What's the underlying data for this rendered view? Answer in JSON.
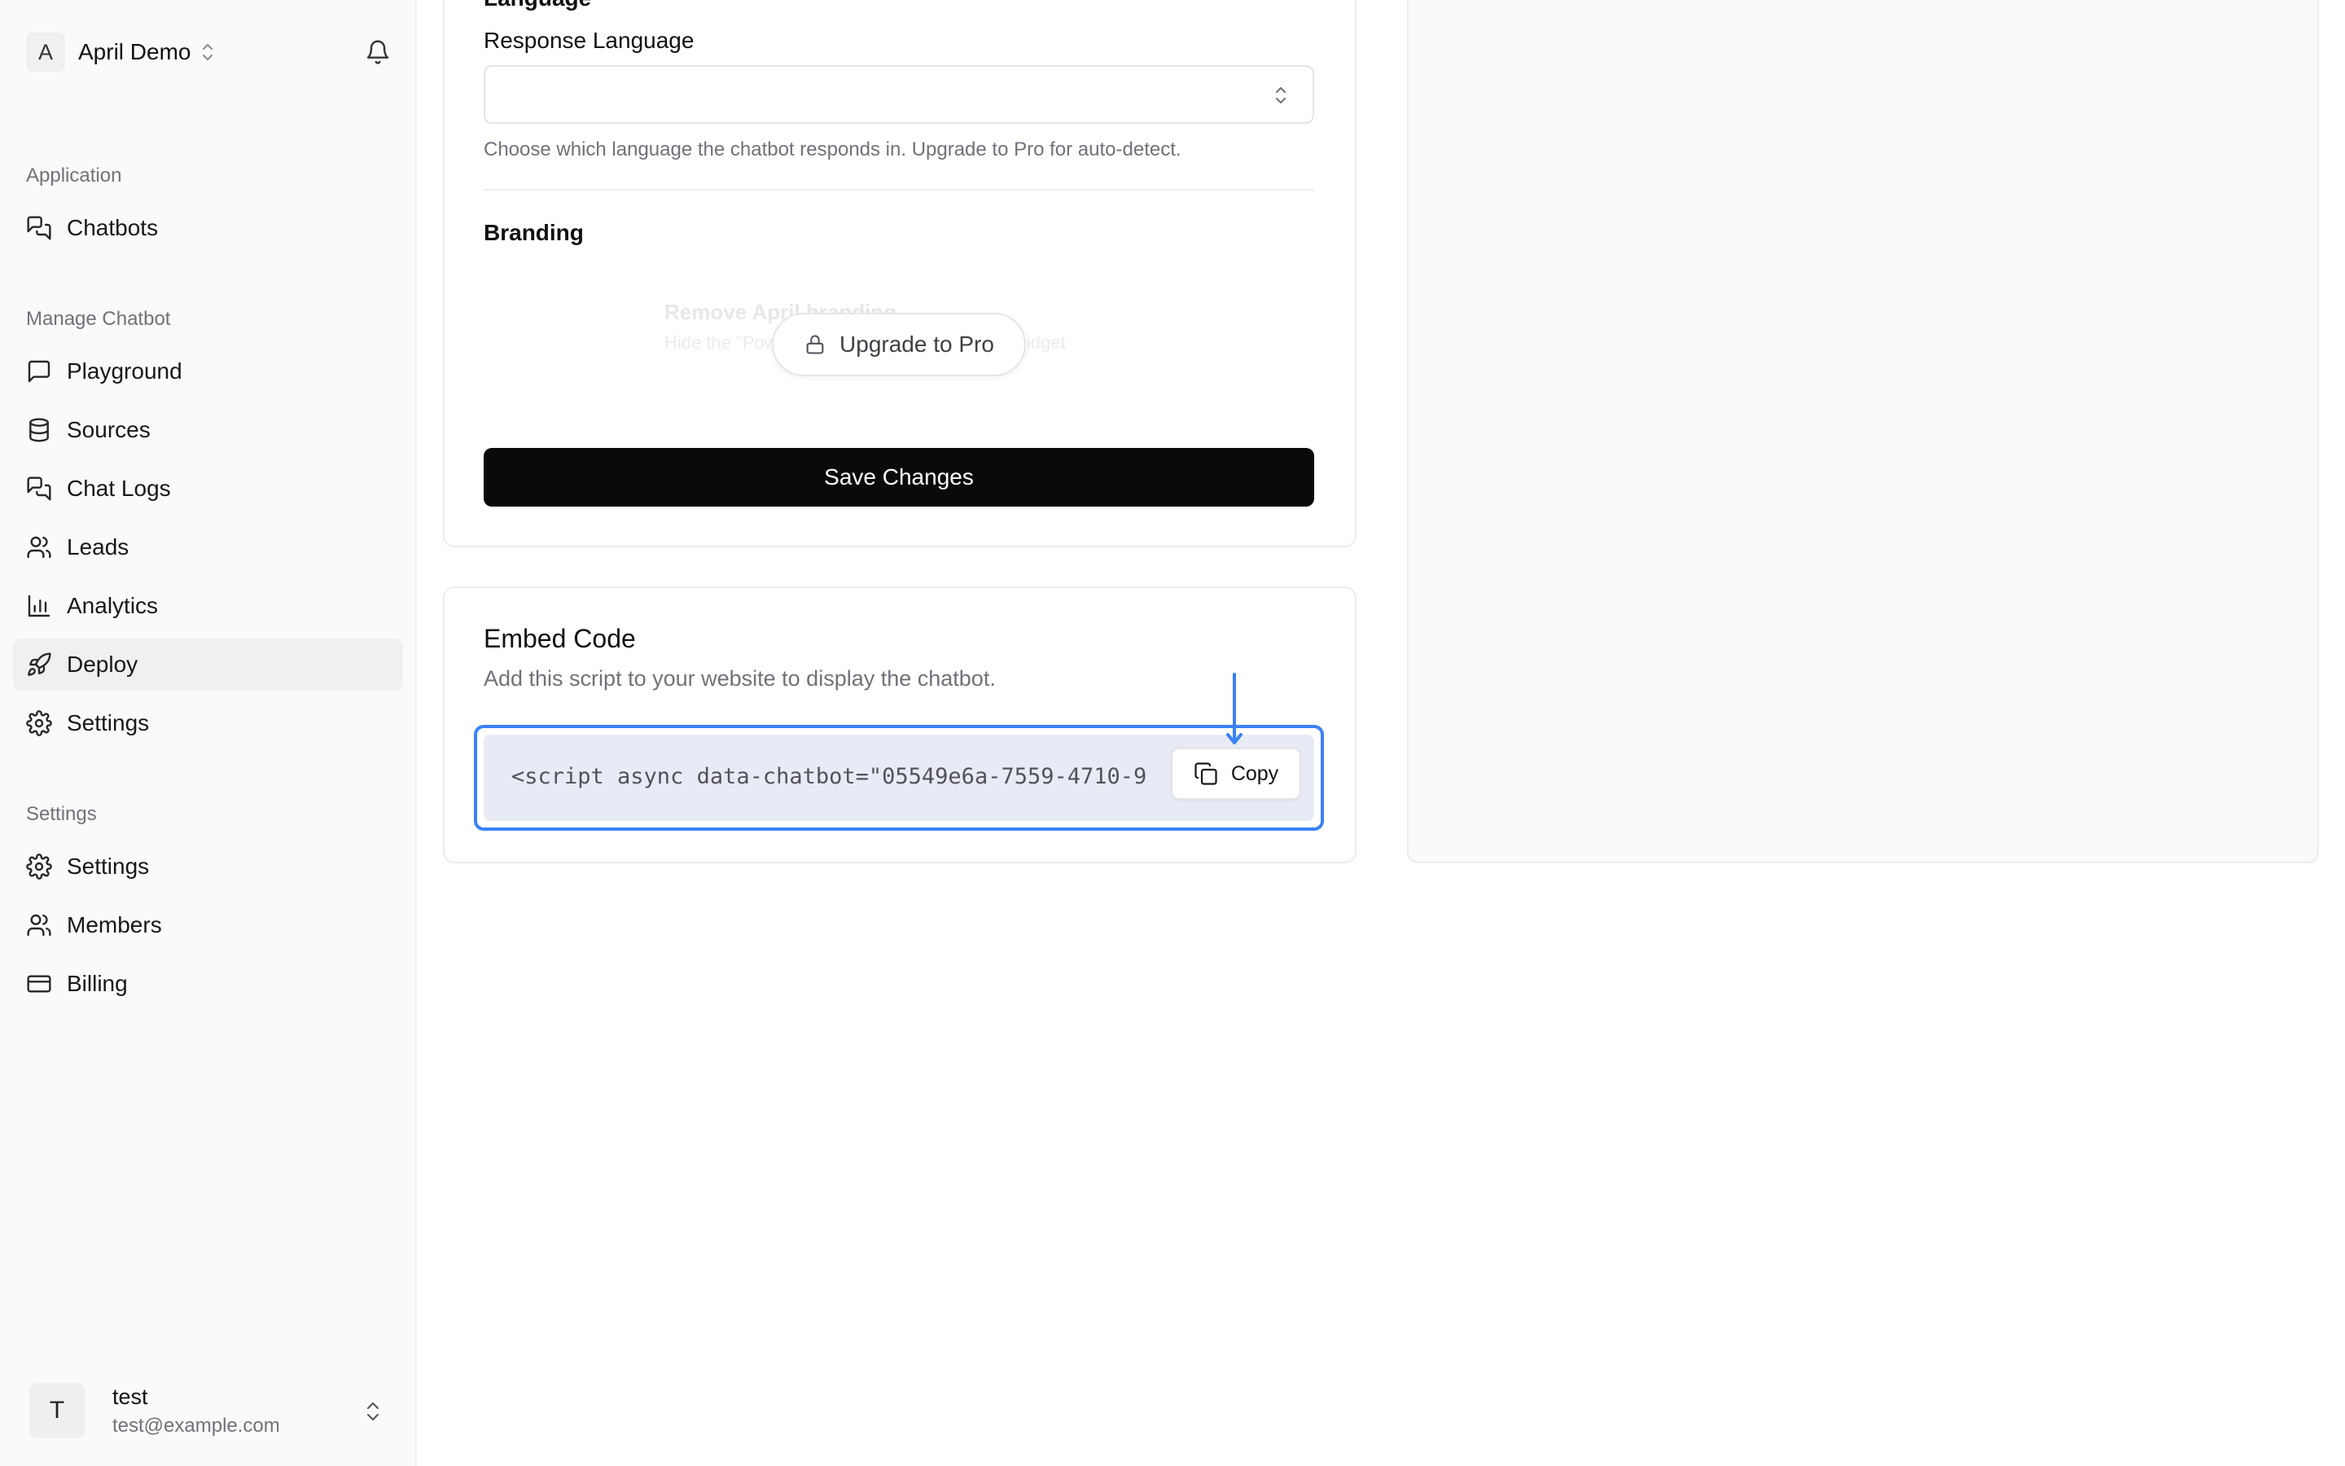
{
  "workspace": {
    "avatar_letter": "A",
    "name": "April Demo"
  },
  "sidebar": {
    "sections": [
      {
        "label": "Application"
      },
      {
        "label": "Manage Chatbot"
      },
      {
        "label": "Settings"
      }
    ],
    "items": [
      {
        "label": "Chatbots",
        "icon": "chat-bubbles-icon"
      },
      {
        "label": "Playground",
        "icon": "message-square-icon"
      },
      {
        "label": "Sources",
        "icon": "database-icon"
      },
      {
        "label": "Chat Logs",
        "icon": "chat-bubbles-icon"
      },
      {
        "label": "Leads",
        "icon": "users-icon"
      },
      {
        "label": "Analytics",
        "icon": "bar-chart-icon"
      },
      {
        "label": "Deploy",
        "icon": "rocket-icon",
        "active": true
      },
      {
        "label": "Settings",
        "icon": "gear-icon"
      },
      {
        "label": "Settings",
        "icon": "gear-icon"
      },
      {
        "label": "Members",
        "icon": "users-icon"
      },
      {
        "label": "Billing",
        "icon": "credit-card-icon"
      }
    ]
  },
  "user": {
    "avatar_letter": "T",
    "name": "test",
    "email": "test@example.com"
  },
  "settings_card": {
    "section_title": "Language",
    "response_language_label": "Response Language",
    "response_language_value": "",
    "response_language_help": "Choose which language the chatbot responds in. Upgrade to Pro for auto-detect.",
    "branding_title": "Branding",
    "branding_option_title": "Remove April branding",
    "branding_option_desc": "Hide the \"Powered by April\" badge from the widget",
    "upgrade_label": "Upgrade to Pro",
    "save_label": "Save Changes"
  },
  "embed_card": {
    "title": "Embed Code",
    "description": "Add this script to your website to display the chatbot.",
    "code": "<script async data-chatbot=\"05549e6a-7559-4710-9",
    "copy_label": "Copy"
  },
  "colors": {
    "accent": "#3b82f6",
    "primary_button": "#0a0a0a",
    "code_bg": "#e8ebf5"
  }
}
